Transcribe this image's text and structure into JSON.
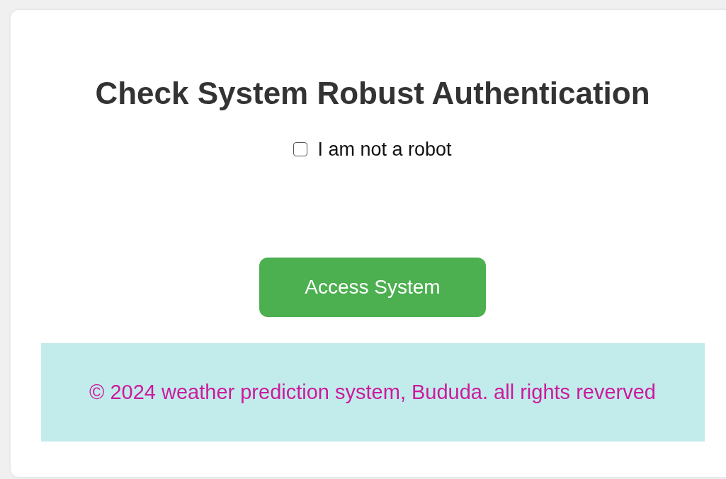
{
  "title": "Check System Robust Authentication",
  "checkbox": {
    "label": "I am not a robot",
    "checked": false
  },
  "button": {
    "label": "Access System"
  },
  "footer": {
    "text": "© 2024 weather prediction system, Bududa. all rights reverved"
  }
}
